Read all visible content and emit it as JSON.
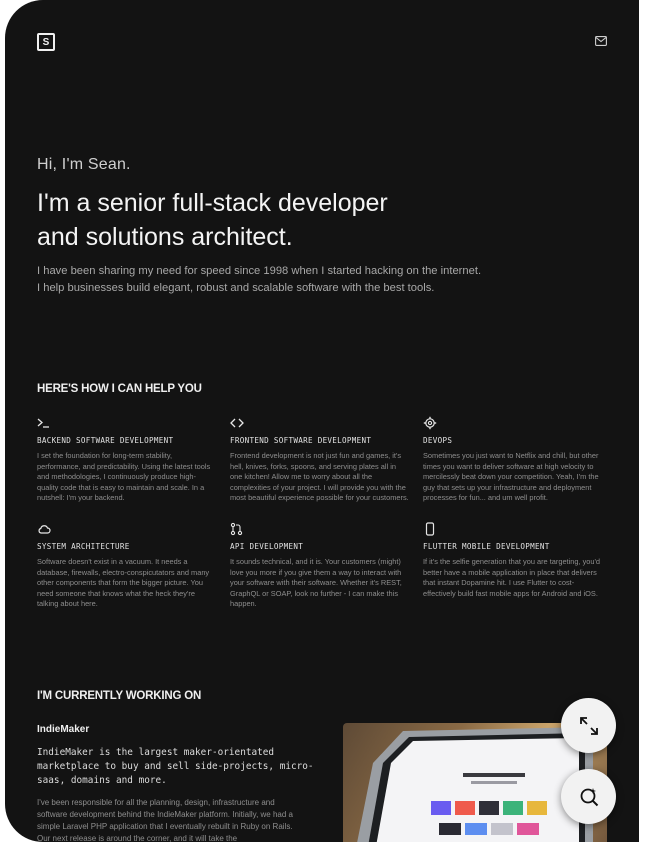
{
  "header": {
    "logo_letter": "S",
    "mail_icon": "mail-icon"
  },
  "hero": {
    "greeting": "Hi, I'm Sean.",
    "headline_line1": "I'm a senior full-stack developer",
    "headline_line2": "and solutions architect.",
    "intro": "I have been sharing my need for speed since 1998 when I started hacking on the internet. I help businesses build elegant, robust and scalable software with the best tools."
  },
  "services": {
    "title": "HERE'S HOW I CAN HELP YOU",
    "items": [
      {
        "icon": "terminal-icon",
        "title": "BACKEND SOFTWARE DEVELOPMENT",
        "desc": "I set the foundation for long-term stability, performance, and predictability. Using the latest tools and methodologies, I continuously produce high-quality code that is easy to maintain and scale. In a nutshell: I'm your backend."
      },
      {
        "icon": "code-icon",
        "title": "FRONTEND SOFTWARE DEVELOPMENT",
        "desc": "Frontend development is not just fun and games, it's hell, knives, forks, spoons, and serving plates all in one kitchen! Allow me to worry about all the complexities of your project. I will provide you with the most beautiful experience possible for your customers."
      },
      {
        "icon": "gear-icon",
        "title": "DEVOPS",
        "desc": "Sometimes you just want to Netflix and chill, but other times you want to deliver software at high velocity to mercilessly beat down your competition. Yeah, I'm the guy that sets up your infrastructure and deployment processes for fun... and um well profit."
      },
      {
        "icon": "cloud-icon",
        "title": "SYSTEM ARCHITECTURE",
        "desc": "Software doesn't exist in a vacuum. It needs a database, firewalls, electro-conspicutators and many other components that form the bigger picture. You need someone that knows what the heck they're talking about here."
      },
      {
        "icon": "git-pull-icon",
        "title": "API DEVELOPMENT",
        "desc": "It sounds technical, and it is. Your customers (might) love you more if you give them a way to interact with your software with their software. Whether it's REST, GraphQL or SOAP, look no further - I can make this happen."
      },
      {
        "icon": "phone-icon",
        "title": "FLUTTER MOBILE DEVELOPMENT",
        "desc": "If it's the selfie generation that you are targeting, you'd better have a mobile application in place that delivers that instant Dopamine hit. I use Flutter to cost-effectively build fast mobile apps for Android and iOS."
      }
    ]
  },
  "working": {
    "title": "I'M CURRENTLY WORKING ON",
    "project_name": "IndieMaker",
    "project_tagline": "IndieMaker is the largest maker-orientated marketplace to buy and sell side-projects, micro-saas, domains and more.",
    "project_desc": "I've been responsible for all the planning, design, infrastructure and software development behind the IndieMaker platform. Initially, we had a simple Laravel PHP application that I eventually rebuilt in Ruby on Rails. Our next release is around the corner, and it will take the"
  },
  "fabs": {
    "expand": "expand-icon",
    "search": "ai-search-icon"
  },
  "colors": {
    "background": "#131313",
    "text": "#e8e8e8",
    "muted": "#8e8e8e"
  }
}
